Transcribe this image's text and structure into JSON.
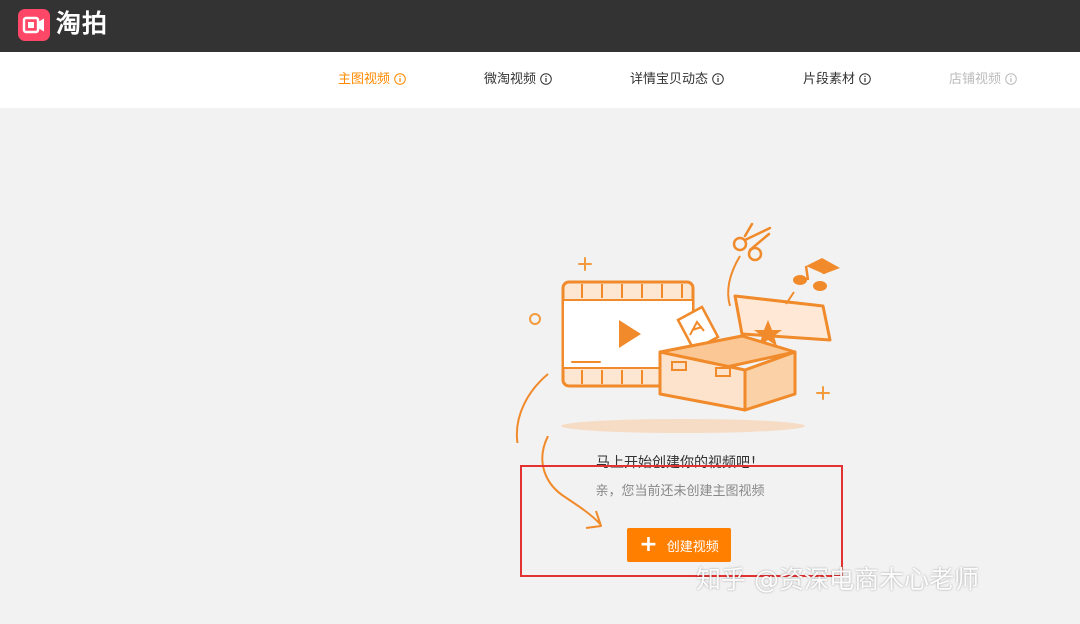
{
  "app": {
    "name": "淘拍"
  },
  "tabs": [
    {
      "label": "主图视频",
      "state": "active"
    },
    {
      "label": "微淘视频",
      "state": "normal"
    },
    {
      "label": "详情宝贝动态",
      "state": "normal"
    },
    {
      "label": "片段素材",
      "state": "normal"
    },
    {
      "label": "店铺视频",
      "state": "disabled"
    }
  ],
  "empty_state": {
    "headline": "马上开始创建你的视频吧！",
    "subtext": "亲，您当前还未创建主图视频",
    "button_label": "创建视频"
  },
  "watermark": "知乎 @资深电商木心老师",
  "colors": {
    "topbar": "#333333",
    "accent": "#ff7f00",
    "active_tab": "#ff8a00",
    "logo": "#ff4868",
    "highlight": "#e23232"
  }
}
